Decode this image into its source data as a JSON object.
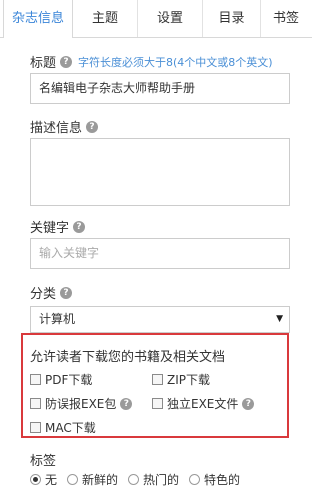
{
  "tabs": [
    {
      "label": "杂志信息",
      "active": true
    },
    {
      "label": "主题",
      "active": false
    },
    {
      "label": "设置",
      "active": false
    },
    {
      "label": "目录",
      "active": false
    },
    {
      "label": "书签",
      "active": false
    }
  ],
  "title_field": {
    "label": "标题",
    "hint": "字符长度必须大于8(4个中文或8个英文)",
    "value": "名编辑电子杂志大师帮助手册"
  },
  "description_field": {
    "label": "描述信息",
    "value": ""
  },
  "keywords_field": {
    "label": "关键字",
    "placeholder": "输入关键字"
  },
  "category_field": {
    "label": "分类",
    "value": "计算机"
  },
  "download": {
    "heading": "允许读者下载您的书籍及相关文档",
    "options": [
      {
        "label": "PDF下载",
        "checked": false
      },
      {
        "label": "ZIP下载",
        "checked": false
      },
      {
        "label": "防误报EXE包",
        "checked": false,
        "help": true
      },
      {
        "label": "独立EXE文件",
        "checked": false,
        "help": true
      },
      {
        "label": "MAC下载",
        "checked": false
      }
    ]
  },
  "tags_field": {
    "label": "标签",
    "options": [
      {
        "label": "无",
        "selected": true
      },
      {
        "label": "新鲜的",
        "selected": false
      },
      {
        "label": "热门的",
        "selected": false
      },
      {
        "label": "特色的",
        "selected": false
      }
    ]
  },
  "colors": {
    "accent": "#3a85d8",
    "highlight_border": "#d9393c"
  }
}
